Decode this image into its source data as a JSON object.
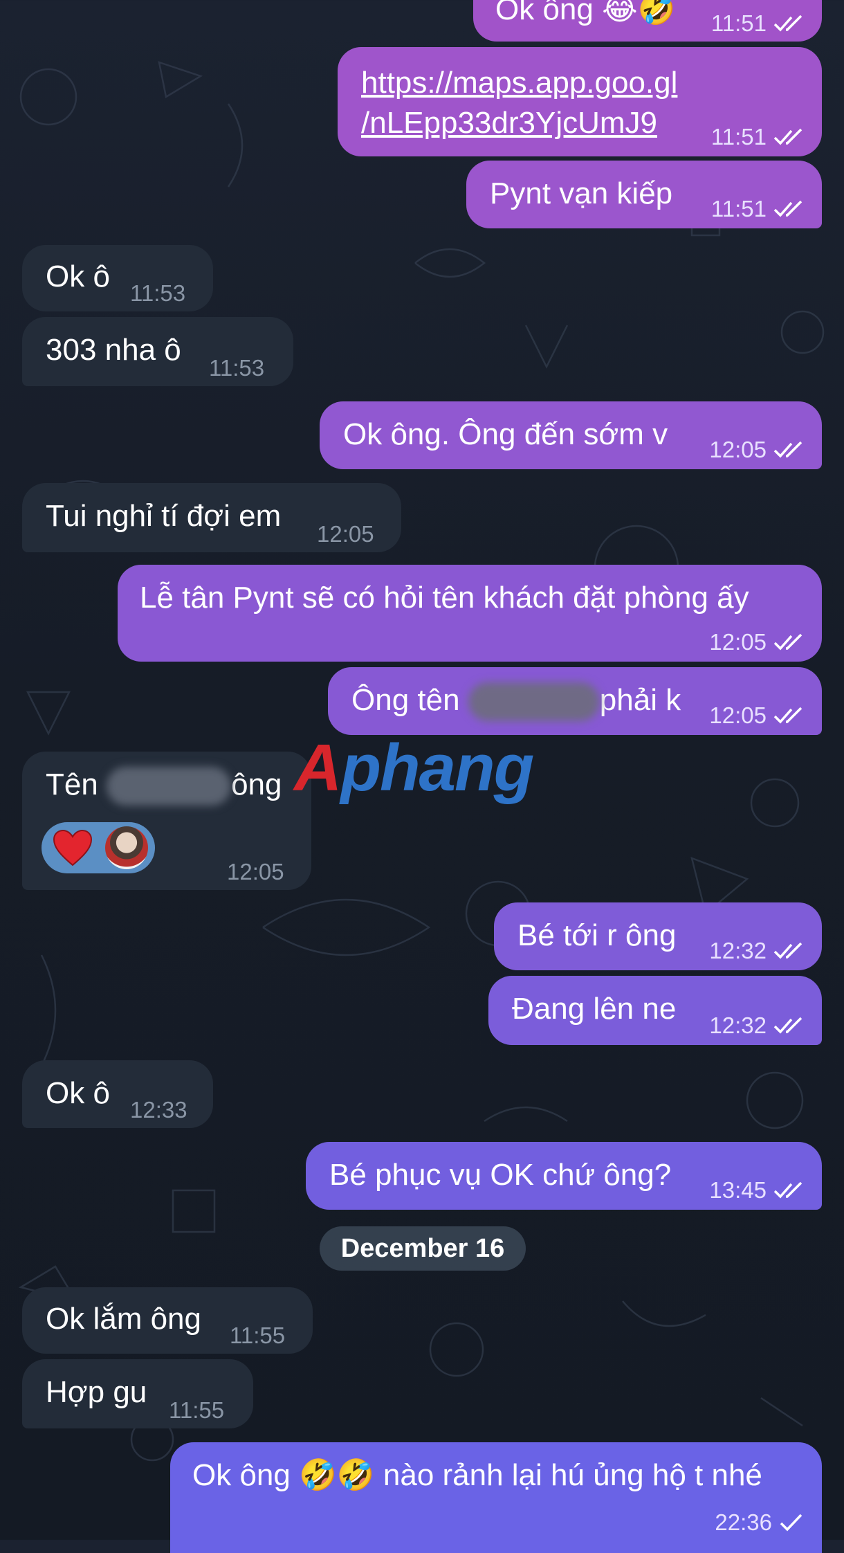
{
  "colors": {
    "outgoing_bubble": "#8a55cf",
    "outgoing_bubble_bottom": "#6a63e6",
    "incoming_bubble": "#232c39",
    "reaction_pill": "#5b8fc4",
    "watermark_red": "#d8262c",
    "watermark_blue": "#2e73c8"
  },
  "messages": [
    {
      "dir": "out",
      "text": "Ok ông 😂🤣",
      "time": "11:51",
      "status": "read"
    },
    {
      "dir": "out",
      "line1": "https://maps.app.goo.gl",
      "line2": "/nLEpp33dr3YjcUmJ9",
      "time": "11:51",
      "status": "read"
    },
    {
      "dir": "out",
      "text": "Pynt vạn kiếp",
      "time": "11:51",
      "status": "read"
    },
    {
      "dir": "in",
      "text": "Ok ô",
      "time": "11:53"
    },
    {
      "dir": "in",
      "text": "303 nha ô",
      "time": "11:53"
    },
    {
      "dir": "out",
      "text": "Ok ông. Ông đến sớm v",
      "time": "12:05",
      "status": "read"
    },
    {
      "dir": "in",
      "text": "Tui nghỉ tí đợi em",
      "time": "12:05"
    },
    {
      "dir": "out",
      "text": "Lễ tân Pynt sẽ có hỏi tên khách đặt phòng ấy",
      "time": "12:05",
      "status": "read"
    },
    {
      "dir": "out",
      "text_before": "Ông tên",
      "text_after": "phải k",
      "time": "12:05",
      "status": "read"
    },
    {
      "dir": "in",
      "text_before": "Tên",
      "text_after": "ông",
      "time": "12:05",
      "reaction": {
        "emoji": "❤️",
        "icon": "heart-icon"
      }
    },
    {
      "dir": "out",
      "text": "Bé tới r ông",
      "time": "12:32",
      "status": "read"
    },
    {
      "dir": "out",
      "text": "Đang lên ne",
      "time": "12:32",
      "status": "read"
    },
    {
      "dir": "in",
      "text": "Ok ô",
      "time": "12:33"
    },
    {
      "dir": "out",
      "text": "Bé phục vụ OK chứ ông?",
      "time": "13:45",
      "status": "read"
    },
    {
      "dir": "in",
      "text": "Ok lắm ông",
      "time": "11:55"
    },
    {
      "dir": "in",
      "text": "Hợp gu",
      "time": "11:55"
    },
    {
      "dir": "out",
      "text": "Ok ông 🤣🤣 nào rảnh lại hú ủng hộ t nhé",
      "time": "22:36",
      "status": "sent"
    }
  ],
  "date_separator": "December 16",
  "watermark": {
    "part1": "A",
    "part2": "phang"
  }
}
